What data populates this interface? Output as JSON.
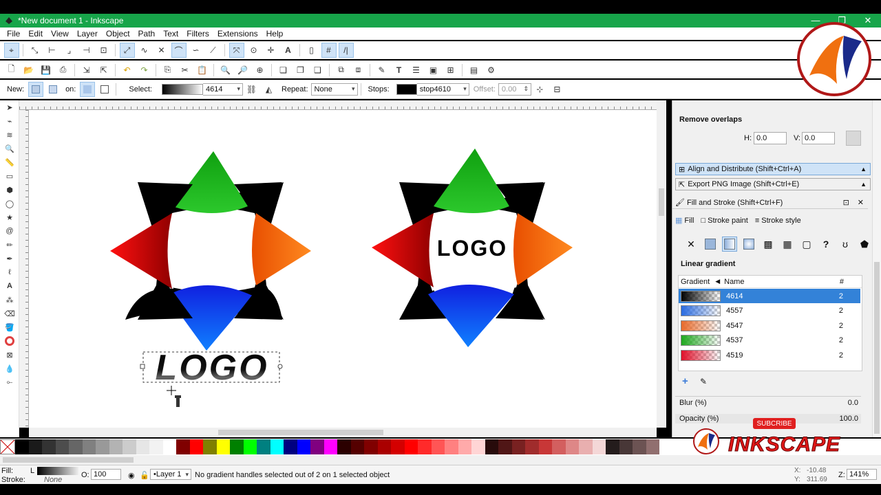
{
  "window": {
    "title": "*New document 1 - Inkscape",
    "controls": [
      "—",
      "❐",
      "✕"
    ]
  },
  "menu": [
    "File",
    "Edit",
    "View",
    "Layer",
    "Object",
    "Path",
    "Text",
    "Filters",
    "Extensions",
    "Help"
  ],
  "gradient_toolbar": {
    "new_label": "New:",
    "on_label": "on:",
    "select_label": "Select:",
    "select_value": "4614",
    "repeat_label": "Repeat:",
    "repeat_value": "None",
    "stops_label": "Stops:",
    "stops_value": "stop4610",
    "offset_label": "Offset:",
    "offset_value": "0.00"
  },
  "canvas": {
    "logo_text_inside": "LOGO",
    "logo_text_below": "LOGO",
    "colors": {
      "green": "#10a010",
      "orange": "#f07010",
      "blue": "#1030ff",
      "red": "#d01010",
      "black": "#000000"
    }
  },
  "dock": {
    "remove_overlaps": "Remove overlaps",
    "h_label": "H:",
    "h_value": "0.0",
    "v_label": "V:",
    "v_value": "0.0",
    "align_distribute": "Align and Distribute (Shift+Ctrl+A)",
    "export_png": "Export PNG Image (Shift+Ctrl+E)",
    "fill_stroke": "Fill and Stroke (Shift+Ctrl+F)",
    "tab_fill": "Fill",
    "tab_stroke_paint": "Stroke paint",
    "tab_stroke_style": "Stroke style",
    "linear_gradient": "Linear gradient",
    "col_gradient": "Gradient",
    "col_name": "Name",
    "col_count": "#",
    "gradients": [
      {
        "name": "4614",
        "count": "2",
        "color": "#000000",
        "selected": true
      },
      {
        "name": "4557",
        "count": "2",
        "color": "#2a6be0",
        "selected": false
      },
      {
        "name": "4547",
        "count": "2",
        "color": "#e86a2a",
        "selected": false
      },
      {
        "name": "4537",
        "count": "2",
        "color": "#1ea81e",
        "selected": false
      },
      {
        "name": "4519",
        "count": "2",
        "color": "#e0102a",
        "selected": false
      }
    ],
    "blur_label": "Blur (%)",
    "blur_value": "0.0",
    "opacity_label": "Opacity (%)",
    "opacity_value": "100.0"
  },
  "overlay": {
    "subscribe": "SUBCRIBE",
    "brand": "INKSCAPE"
  },
  "status": {
    "fill_label": "Fill:",
    "fill_value": "L",
    "stroke_label": "Stroke:",
    "stroke_value": "None",
    "opacity_label": "O:",
    "opacity_value": "100",
    "layer": "•Layer 1",
    "message": "No gradient handles selected out of 2 on 1 selected object",
    "x_label": "X:",
    "x_value": "-10.48",
    "y_label": "Y:",
    "y_value": "311.69",
    "zoom_label": "Z:",
    "zoom_value": "141%"
  },
  "palette": [
    "#000000",
    "#1a1a1a",
    "#333333",
    "#4d4d4d",
    "#666666",
    "#808080",
    "#999999",
    "#b3b3b3",
    "#cccccc",
    "#e6e6e6",
    "#f2f2f2",
    "#ffffff",
    "#800000",
    "#ff0000",
    "#808000",
    "#ffff00",
    "#008000",
    "#00ff00",
    "#008080",
    "#00ffff",
    "#000080",
    "#0000ff",
    "#800080",
    "#ff00ff",
    "#2b0000",
    "#550000",
    "#800000",
    "#aa0000",
    "#d40000",
    "#ff0000",
    "#ff2a2a",
    "#ff5555",
    "#ff8080",
    "#ffaaaa",
    "#ffd5d5",
    "#280b0b",
    "#501616",
    "#782121",
    "#a02c2c",
    "#c83737",
    "#d35f5f",
    "#de8787",
    "#e9afaf",
    "#f4d7d7",
    "#241c1c",
    "#483737",
    "#6c5353",
    "#916f6f"
  ]
}
